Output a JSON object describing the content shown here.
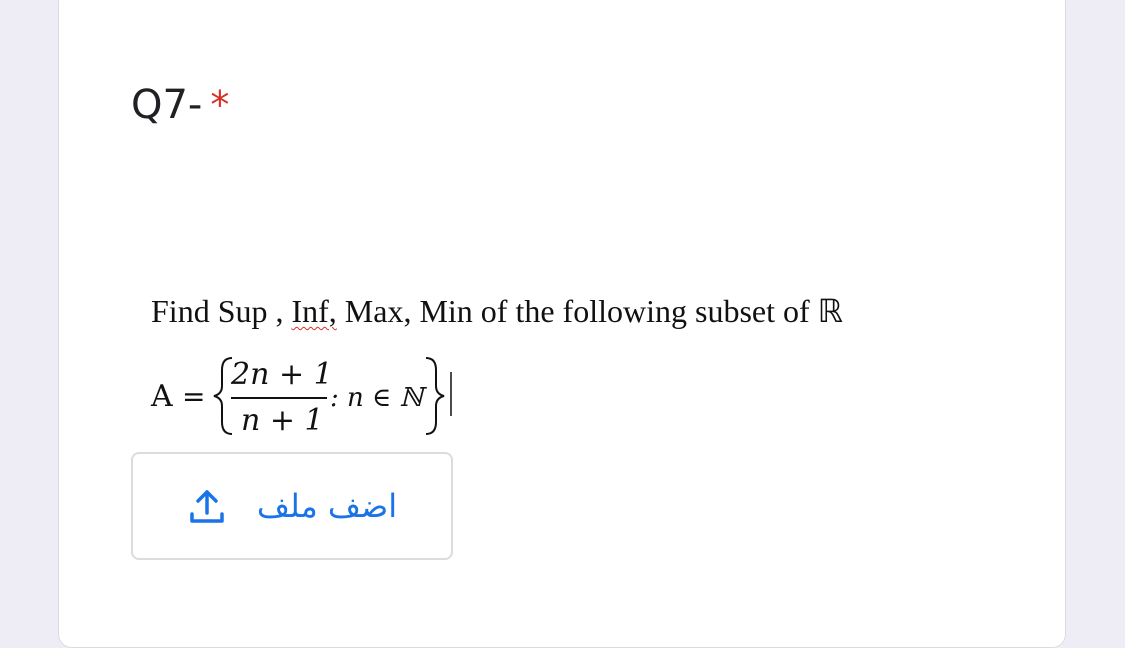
{
  "question": {
    "title": "Q7-",
    "required_marker": "*",
    "problem_text": {
      "part1": "Find Sup , ",
      "part2_misspelled": "Inf,",
      "part3": " Max, Min of the following subset of ℝ"
    },
    "formula": {
      "lhs": "A",
      "equals": "=",
      "numerator": "2n + 1",
      "denominator": "n + 1",
      "condition": ": n ∈ ℕ"
    }
  },
  "upload": {
    "label": "اضف ملف",
    "icon": "upload-icon"
  },
  "colors": {
    "background": "#eeedf6",
    "card": "#ffffff",
    "required": "#d93025",
    "accent": "#1a73e8",
    "border": "#dadce0"
  }
}
